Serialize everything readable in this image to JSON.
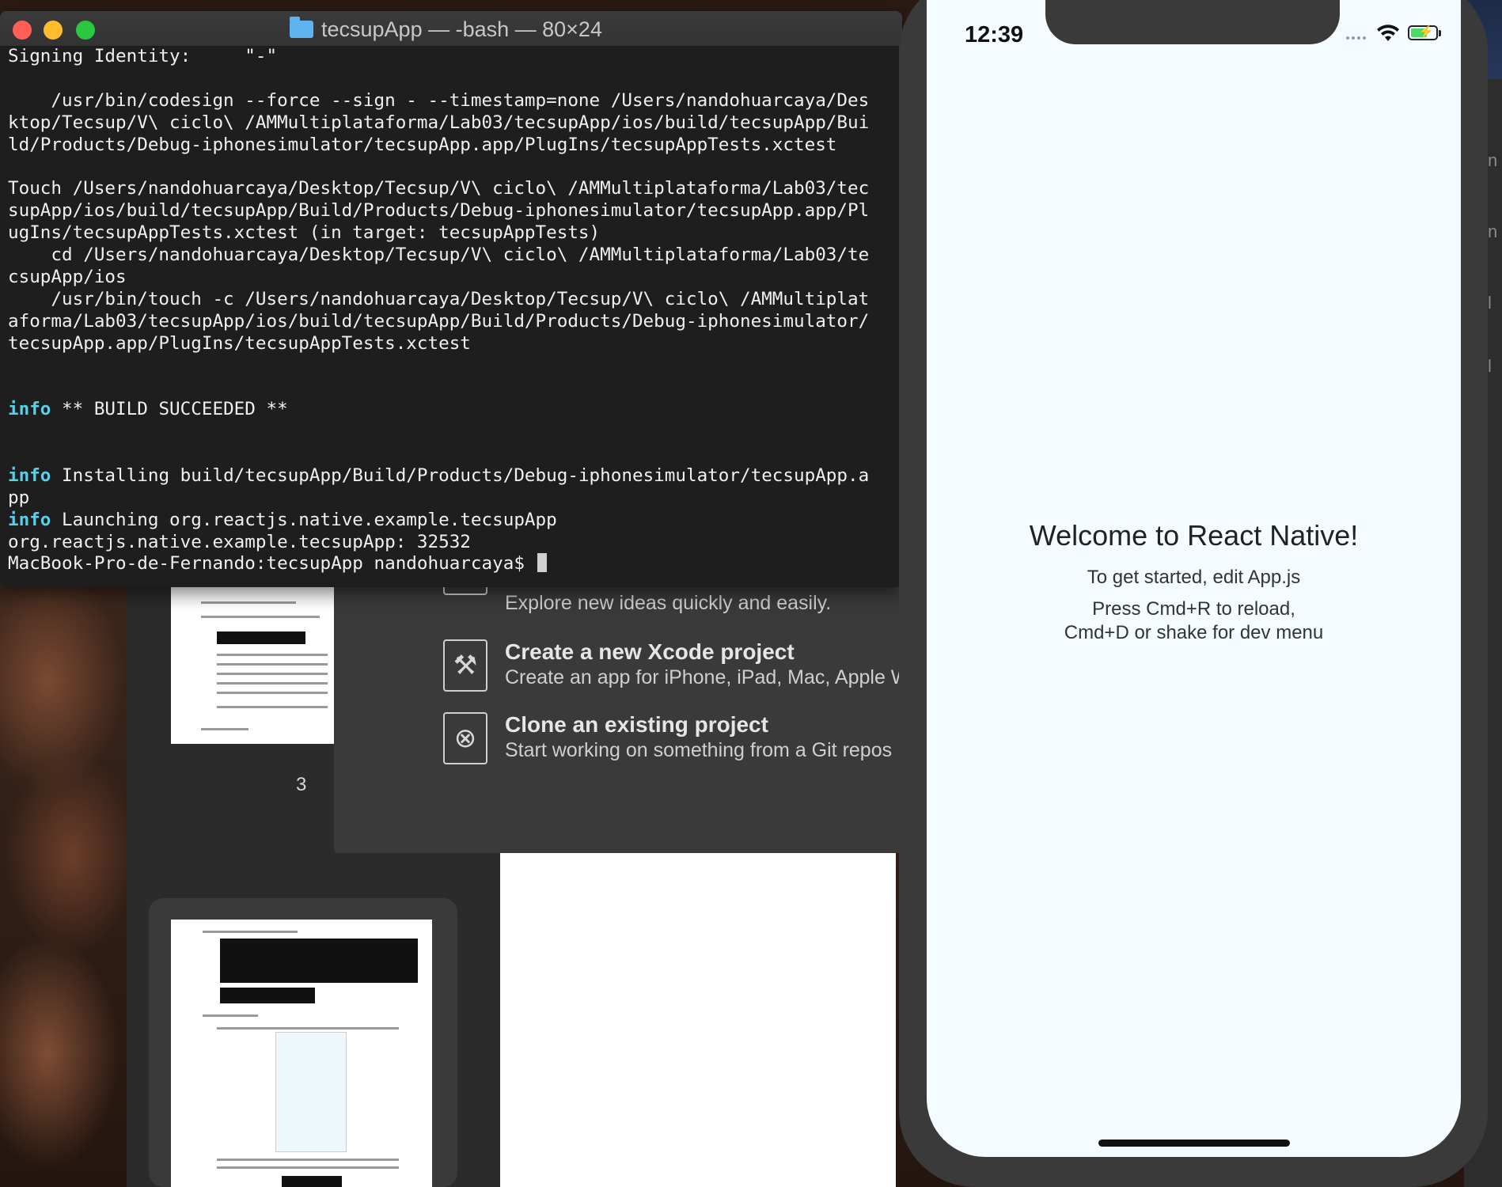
{
  "terminal": {
    "title": "tecsupApp — -bash — 80×24",
    "lines": [
      {
        "text": "Signing Identity:     \"-\""
      },
      {
        "text": ""
      },
      {
        "text": "    /usr/bin/codesign --force --sign - --timestamp=none /Users/nandohuarcaya/Des"
      },
      {
        "text": "ktop/Tecsup/V\\ ciclo\\ /AMMultiplataforma/Lab03/tecsupApp/ios/build/tecsupApp/Bui"
      },
      {
        "text": "ld/Products/Debug-iphonesimulator/tecsupApp.app/PlugIns/tecsupAppTests.xctest"
      },
      {
        "text": ""
      },
      {
        "text": "Touch /Users/nandohuarcaya/Desktop/Tecsup/V\\ ciclo\\ /AMMultiplataforma/Lab03/tec"
      },
      {
        "text": "supApp/ios/build/tecsupApp/Build/Products/Debug-iphonesimulator/tecsupApp.app/Pl"
      },
      {
        "text": "ugIns/tecsupAppTests.xctest (in target: tecsupAppTests)"
      },
      {
        "text": "    cd /Users/nandohuarcaya/Desktop/Tecsup/V\\ ciclo\\ /AMMultiplataforma/Lab03/te"
      },
      {
        "text": "csupApp/ios"
      },
      {
        "text": "    /usr/bin/touch -c /Users/nandohuarcaya/Desktop/Tecsup/V\\ ciclo\\ /AMMultiplat"
      },
      {
        "text": "aforma/Lab03/tecsupApp/ios/build/tecsupApp/Build/Products/Debug-iphonesimulator/"
      },
      {
        "text": "tecsupApp.app/PlugIns/tecsupAppTests.xctest"
      },
      {
        "text": ""
      },
      {
        "text": ""
      },
      {
        "prefix": "info",
        "text": " ** BUILD SUCCEEDED **"
      },
      {
        "text": ""
      },
      {
        "text": ""
      },
      {
        "prefix": "info",
        "text": " Installing build/tecsupApp/Build/Products/Debug-iphonesimulator/tecsupApp.a"
      },
      {
        "text": "pp"
      },
      {
        "prefix": "info",
        "text": " Launching org.reactjs.native.example.tecsupApp"
      },
      {
        "text": "org.reactjs.native.example.tecsupApp: 32532"
      },
      {
        "text": "MacBook-Pro-de-Fernando:tecsupApp nandohuarcaya$ ",
        "cursor": true
      }
    ],
    "info_color": "#5ccfe6"
  },
  "xcode_welcome": {
    "partial_sub": "Explore new ideas quickly and easily.",
    "create_title": "Create a new Xcode project",
    "create_sub": "Create an app for iPhone, iPad, Mac, Apple W",
    "clone_title": "Clone an existing project",
    "clone_sub": "Start working on something from a Git repos"
  },
  "preview": {
    "page_number": "3"
  },
  "simulator": {
    "time": "12:39",
    "welcome": "Welcome to React Native!",
    "instructions": "To get started, edit App.js",
    "reload_line1": "Press Cmd+R to reload,",
    "reload_line2": "Cmd+D or shake for dev menu",
    "battery_color": "#4cd964"
  },
  "icons": [
    "folder-icon",
    "swift-icon",
    "xcode-project-icon",
    "git-clone-icon",
    "wifi-icon",
    "battery-icon"
  ]
}
